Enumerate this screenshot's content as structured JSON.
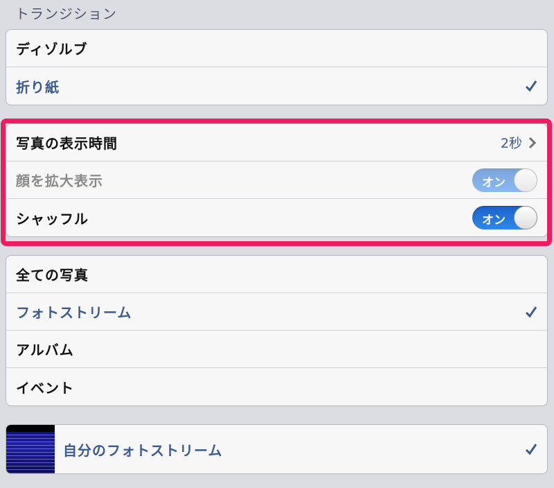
{
  "transition_section": {
    "header": "トランジション",
    "items": [
      {
        "label": "ディゾルブ",
        "selected": false
      },
      {
        "label": "折り紙",
        "selected": true
      }
    ]
  },
  "display_settings": {
    "photo_duration": {
      "label": "写真の表示時間",
      "value": "2秒"
    },
    "zoom_faces": {
      "label": "顔を拡大表示",
      "toggle_text": "オン",
      "on": true,
      "enabled": false
    },
    "shuffle": {
      "label": "シャッフル",
      "toggle_text": "オン",
      "on": true,
      "enabled": true
    }
  },
  "source_section": {
    "items": [
      {
        "label": "全ての写真",
        "selected": false
      },
      {
        "label": "フォトストリーム",
        "selected": true
      },
      {
        "label": "アルバム",
        "selected": false
      },
      {
        "label": "イベント",
        "selected": false
      }
    ]
  },
  "my_photostream": {
    "label": "自分のフォトストリーム",
    "selected": true
  },
  "colors": {
    "accent": "#3d5a8f",
    "toggle_on": "#2a79dd",
    "highlight": "#ee1c60"
  }
}
